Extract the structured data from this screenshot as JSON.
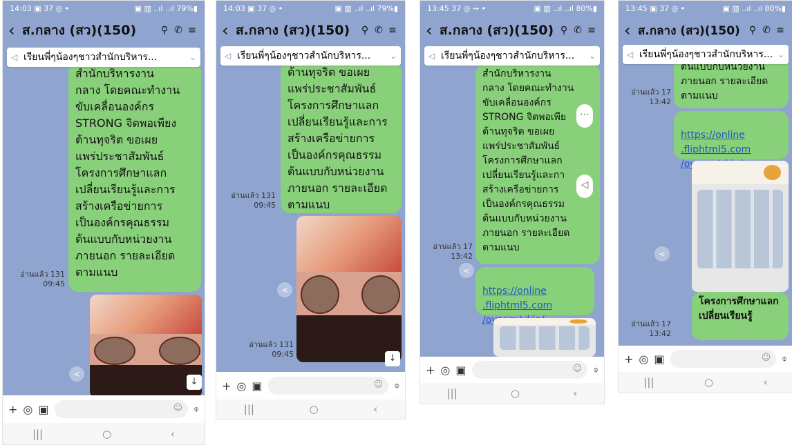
{
  "app": {
    "title": "ส.กลาง (สว)(150)"
  },
  "pinned": {
    "text": "เรียนพี่ๆน้องๆชาวสำนักบริหาร..."
  },
  "screens": [
    {
      "status": {
        "time": "14:03 ▣ 37 ◎ •",
        "right": "▣ ▥ ..ıl ..ıl 79%▮"
      },
      "msg": "สำนักบริหารงาน\nกลาง โดยคณะทำงาน\nขับเคลื่อนองค์กร\nSTRONG จิตพอเพียง\nต้านทุจริต ขอเผย\nแพร่ประชาสัมพันธ์\nโครงการศึกษาแลก\nเปลี่ยนเรียนรู้และการ\nสร้างเครือข่ายการ\nเป็นองค์กรคุณธรรม\nต้นแบบกับหน่วยงาน\nภายนอก รายละเอียด\nตามแนบ",
      "read": "อ่านแล้ว 131\n09:45"
    },
    {
      "status": {
        "time": "14:03 ▣ 37 ◎ •",
        "right": "▣ ▥ ..ıl ..ıl 79%▮"
      },
      "msg": "ต้านทุจริต ขอเผย\nแพร่ประชาสัมพันธ์\nโครงการศึกษาแลก\nเปลี่ยนเรียนรู้และการ\nสร้างเครือข่ายการ\nเป็นองค์กรคุณธรรม\nต้นแบบกับหน่วยงาน\nภายนอก รายละเอียด\nตามแนบ",
      "read": "อ่านแล้ว 131\n09:45",
      "read2": "อ่านแล้ว 131\n09:45"
    },
    {
      "status": {
        "time": "13:45 37 ◎ ⇝ •",
        "right": "▣ ▥ ..ıl ..ıl 80%▮"
      },
      "msg": "สำนักบริหารงาน\nกลาง โดยคณะทำงาน\nขับเคลื่อนองค์กร\nSTRONG จิตพอเพีย\nต้านทุจริต ขอเผย\nแพร่ประชาสัมพันธ์\nโครงการศึกษาแลก\nเปลี่ยนเรียนรู้และกา\nสร้างเครือข่ายการ\nเป็นองค์กรคุณธรรม\nต้นแบบกับหน่วยงาน\nภายนอก รายละเอียด\nตามแนบ",
      "read": "อ่านแล้ว 17\n13:42",
      "link": "https://online\n.fliphtml5.com\n/oyzqm/vkia/"
    },
    {
      "status": {
        "time": "13:45 ▣ 37 ◎ •",
        "right": "▣ ▥ ..ıl ..ıl 80%▮"
      },
      "msg": "ต้นแบบกับหน่วยงาน\nภายนอก รายละเอียด\nตามแนบ",
      "read": "อ่านแล้ว 17\n13:42",
      "link": "https://online\n.fliphtml5.com\n/oyzqm/vkia/",
      "caption": "โครงการศึกษาแลก\nเปลี่ยนเรียนรู้",
      "read2": "อ่านแล้ว 17\n13:42"
    }
  ],
  "icons": {
    "back": "‹",
    "search": "⚲",
    "call": "✆",
    "menu": "≡",
    "plus": "+",
    "camera": "◎",
    "gallery": "▣",
    "emoji": "☺",
    "mic": "🎙",
    "down": "↓",
    "nav_recent": "|||",
    "nav_home": "○",
    "nav_back": "‹"
  }
}
